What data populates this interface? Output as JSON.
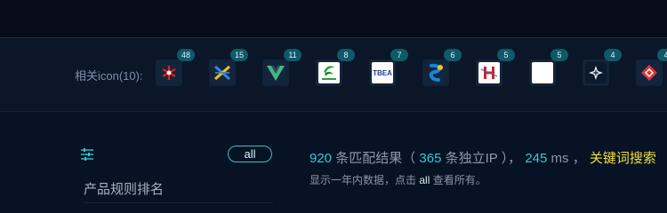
{
  "related": {
    "label": "相关icon(10):",
    "icons": [
      {
        "name": "red-starburst-icon",
        "count": "48"
      },
      {
        "name": "blue-yellow-cross-icon",
        "count": "15"
      },
      {
        "name": "vue-icon",
        "count": "11"
      },
      {
        "name": "green-china-mobile-icon",
        "count": "8"
      },
      {
        "name": "tbea-icon",
        "count": "7",
        "text": "TBEA"
      },
      {
        "name": "blue-s-icon",
        "count": "6"
      },
      {
        "name": "red-h-icon",
        "count": "5"
      },
      {
        "name": "white-square-icon",
        "count": "5"
      },
      {
        "name": "star-diamond-icon",
        "count": "4"
      },
      {
        "name": "red-diamond-icon",
        "count": "4"
      }
    ]
  },
  "filters": {
    "all_label": "all",
    "rule_label": "产品规则排名"
  },
  "summary": {
    "count": "920",
    "count_text": "条匹配结果（",
    "ip_count": "365",
    "ip_text": "条独立IP ），",
    "time": "245",
    "time_unit": "ms ，",
    "keyword_text": "关键词搜索",
    "line2_prefix": "显示一年内数据，点击",
    "line2_link": "all",
    "line2_suffix": "查看所有。"
  },
  "colors": {
    "background": "#071224",
    "accent": "#2cc7c7",
    "highlight": "#f0de3c"
  }
}
